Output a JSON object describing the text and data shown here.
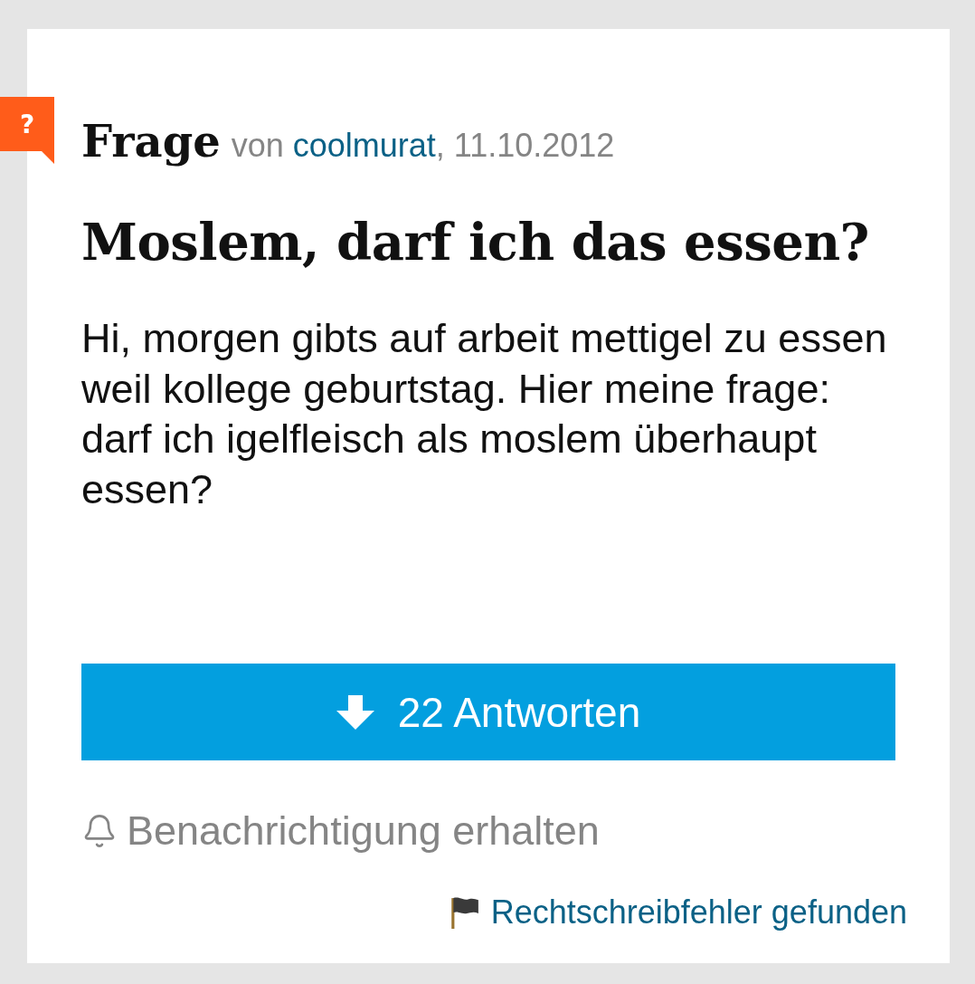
{
  "question_header": {
    "badge": "?",
    "label": "Frage",
    "meta": {
      "prefix": "von",
      "author": "coolmurat",
      "suffix": ", 11.10.2012"
    }
  },
  "title": "Moslem, darf ich das essen?",
  "body": "Hi, morgen gibts auf arbeit mettigel zu essen weil kollege geburtstag. Hier meine frage: darf ich igelfleisch als moslem überhaupt essen?",
  "answers_button": {
    "label": "22 Antworten"
  },
  "notify_link": {
    "label": "Benachrichtigung erhalten"
  },
  "report_link": {
    "label": "Rechtschreibfehler gefunden"
  }
}
